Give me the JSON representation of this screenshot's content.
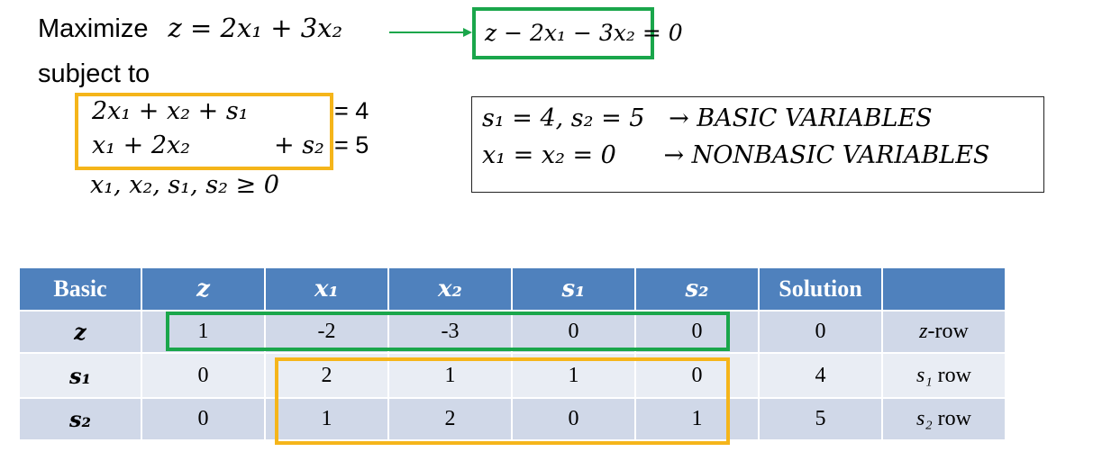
{
  "problem": {
    "maximize_word": "Maximize",
    "objective": "z = 2x₁ + 3x₂",
    "subject_to": "subject to",
    "constraint_1_lhs": "2x₁ + x₂ + s₁",
    "constraint_1_rhs": "= 4",
    "constraint_2_lhs": "x₁ + 2x₂",
    "constraint_2_slack": "+ s₂",
    "constraint_2_rhs": "= 5",
    "nonnegativity": "x₁, x₂, s₁, s₂ ≥ 0"
  },
  "objective_row_equation": "z − 2x₁ − 3x₂ = 0",
  "basis_info": {
    "basic_assignment": "s₁ = 4, s₂ = 5",
    "basic_label": "→ BASIC VARIABLES",
    "nonbasic_assignment": "x₁ = x₂ = 0",
    "nonbasic_label": "→ NONBASIC VARIABLES"
  },
  "tableau": {
    "headers": [
      "Basic",
      "z",
      "x₁",
      "x₂",
      "s₁",
      "s₂",
      "Solution",
      ""
    ],
    "rows": [
      {
        "basic": "z",
        "cells": [
          "1",
          "-2",
          "-3",
          "0",
          "0",
          "0"
        ],
        "label_var": "z",
        "label_text": "-row"
      },
      {
        "basic": "s₁",
        "cells": [
          "0",
          "2",
          "1",
          "1",
          "0",
          "4"
        ],
        "label_var": "s₁",
        "label_text": " row"
      },
      {
        "basic": "s₂",
        "cells": [
          "0",
          "1",
          "2",
          "0",
          "1",
          "5"
        ],
        "label_var": "s₂",
        "label_text": " row"
      }
    ]
  },
  "colors": {
    "header_bg": "#4f81bd",
    "row_odd_bg": "#d0d8e8",
    "row_even_bg": "#e9edf4",
    "highlight_green": "#1aa64b",
    "highlight_orange": "#f5b51a"
  }
}
